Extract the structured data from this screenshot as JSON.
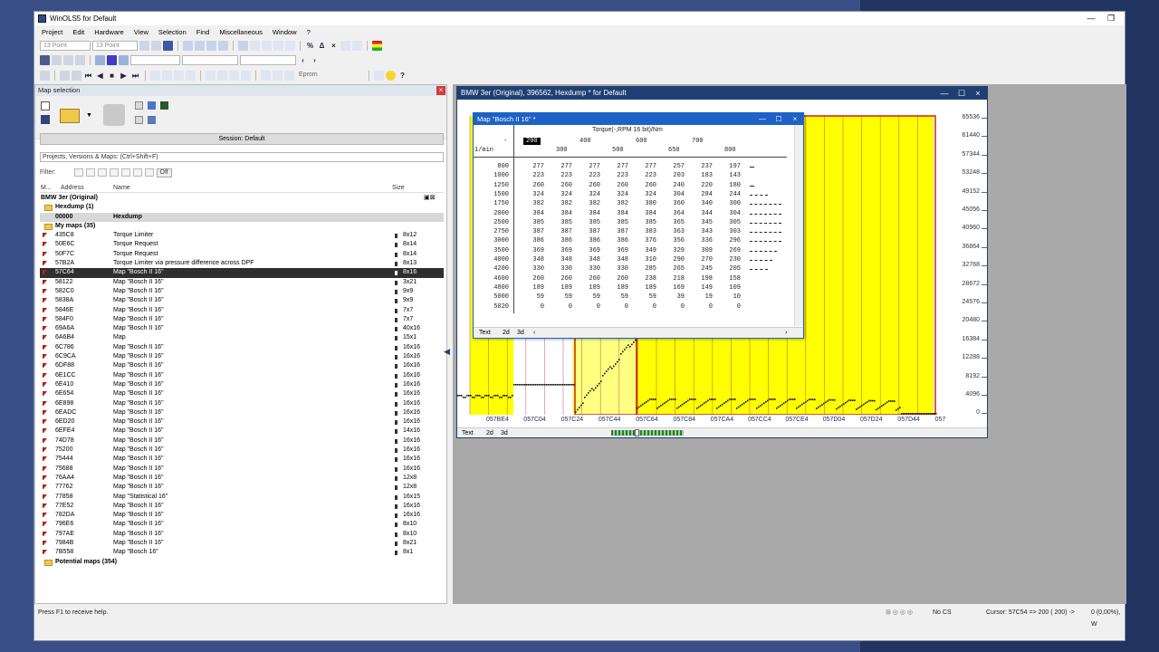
{
  "app": {
    "title": "WinOLS5 for Default"
  },
  "menu": [
    "Project",
    "Edit",
    "Hardware",
    "View",
    "Selection",
    "Find",
    "Miscellaneous",
    "Window",
    "?"
  ],
  "toolbar": {
    "font_size_1": "13 Point",
    "font_size_2": "13 Point",
    "eprom_label": "Eprom"
  },
  "left_panel": {
    "title": "Map selection",
    "session": "Session: Default",
    "projects_placeholder": "Projects, Versions & Maps:  (Ctrl+Shift+F)",
    "filter_label": "Filter:",
    "filter_off": "Off",
    "columns": {
      "m": "M...",
      "address": "Address",
      "name": "Name",
      "size": "Size"
    },
    "project": "BMW 3er (Original)",
    "hexdump_folder": "Hexdump (1)",
    "hexdump_row": {
      "address": "00000",
      "name": "Hexdump"
    },
    "mymaps_folder": "My maps (35)",
    "maps": [
      {
        "address": "435C8",
        "name": "Torque Limiter",
        "size": "8x12"
      },
      {
        "address": "50E6C",
        "name": "Torque Request",
        "size": "8x14"
      },
      {
        "address": "50F7C",
        "name": "Torque Request",
        "size": "8x14"
      },
      {
        "address": "57B2A",
        "name": "Torque Limiter via pressure difference across DPF",
        "size": "8x13"
      },
      {
        "address": "57C64",
        "name": "Map \"Bosch II 16\"",
        "size": "8x16",
        "selected": true
      },
      {
        "address": "58122",
        "name": "Map \"Bosch II 16\"",
        "size": "3x21"
      },
      {
        "address": "582C0",
        "name": "Map \"Bosch II 16\"",
        "size": "9x9"
      },
      {
        "address": "5838A",
        "name": "Map \"Bosch II 16\"",
        "size": "9x9"
      },
      {
        "address": "5846E",
        "name": "Map \"Bosch II 16\"",
        "size": "7x7"
      },
      {
        "address": "584F0",
        "name": "Map \"Bosch II 16\"",
        "size": "7x7"
      },
      {
        "address": "69A6A",
        "name": "Map \"Bosch II 16\"",
        "size": "40x16"
      },
      {
        "address": "6A6B4",
        "name": "Map",
        "size": "15x1"
      },
      {
        "address": "6C786",
        "name": "Map \"Bosch II 16\"",
        "size": "16x16"
      },
      {
        "address": "6C9CA",
        "name": "Map \"Bosch II 16\"",
        "size": "16x16"
      },
      {
        "address": "6DF88",
        "name": "Map \"Bosch II 16\"",
        "size": "16x16"
      },
      {
        "address": "6E1CC",
        "name": "Map \"Bosch II 16\"",
        "size": "16x16"
      },
      {
        "address": "6E410",
        "name": "Map \"Bosch II 16\"",
        "size": "16x16"
      },
      {
        "address": "6E654",
        "name": "Map \"Bosch II 16\"",
        "size": "16x16"
      },
      {
        "address": "6E898",
        "name": "Map \"Bosch II 16\"",
        "size": "16x16"
      },
      {
        "address": "6EADC",
        "name": "Map \"Bosch II 16\"",
        "size": "16x16"
      },
      {
        "address": "6ED20",
        "name": "Map \"Bosch II 16\"",
        "size": "16x16"
      },
      {
        "address": "6EFE4",
        "name": "Map \"Bosch II 16\"",
        "size": "14x16"
      },
      {
        "address": "74D78",
        "name": "Map \"Bosch II 16\"",
        "size": "16x16"
      },
      {
        "address": "75200",
        "name": "Map \"Bosch II 16\"",
        "size": "16x16"
      },
      {
        "address": "75444",
        "name": "Map \"Bosch II 16\"",
        "size": "16x16"
      },
      {
        "address": "75688",
        "name": "Map \"Bosch II 16\"",
        "size": "16x16"
      },
      {
        "address": "76AA4",
        "name": "Map \"Bosch II 16\"",
        "size": "12x8"
      },
      {
        "address": "77762",
        "name": "Map \"Bosch II 16\"",
        "size": "12x8"
      },
      {
        "address": "77858",
        "name": "Map \"Statistical 16\"",
        "size": "16x15"
      },
      {
        "address": "77E52",
        "name": "Map \"Bosch II 16\"",
        "size": "16x16"
      },
      {
        "address": "782DA",
        "name": "Map \"Bosch II 16\"",
        "size": "16x16"
      },
      {
        "address": "796E6",
        "name": "Map \"Bosch II 16\"",
        "size": "8x10"
      },
      {
        "address": "797AE",
        "name": "Map \"Bosch II 16\"",
        "size": "8x10"
      },
      {
        "address": "7984B",
        "name": "Map \"Bosch II 16\"",
        "size": "8x21"
      },
      {
        "address": "7B558",
        "name": "Map \"Bosch 16\"",
        "size": "8x1"
      }
    ],
    "potential_folder": "Potential maps (354)"
  },
  "status": {
    "help": "Press F1 to receive help.",
    "cs": "No CS",
    "cursor": "Cursor: 57C54 =>  200 ( 200) ->",
    "pct": "0 (0,00%), W"
  },
  "hex_window": {
    "title": "BMW 3er (Original), 396562, Hexdump * for Default",
    "ruler": [
      "65536",
      "61440",
      "57344",
      "53248",
      "49152",
      "45056",
      "40960",
      "36864",
      "32768",
      "28672",
      "24576",
      "20480",
      "16384",
      "12288",
      "8192",
      "4096",
      "0"
    ],
    "addresses": [
      "057BE4",
      "057C04",
      "057C24",
      "057C44",
      "057C64",
      "057C84",
      "057CA4",
      "057CC4",
      "057CE4",
      "057D04",
      "057D24",
      "057D44",
      "057"
    ],
    "tabs": [
      "Text",
      "2d",
      "3d"
    ]
  },
  "map_window": {
    "title": "Map \"Bosch II 16\" *",
    "header": "Torque(-,RPM 16 bit)/Nm",
    "row_axis_label": "1/min",
    "dash": "-",
    "cols_top": [
      "200",
      "400",
      "600",
      "700"
    ],
    "cols_bottom": [
      "300",
      "500",
      "650",
      "800"
    ],
    "rows": [
      {
        "rpm": "800",
        "v": [
          "277",
          "277",
          "277",
          "277",
          "277",
          "257",
          "237",
          "197"
        ]
      },
      {
        "rpm": "1000",
        "v": [
          "223",
          "223",
          "223",
          "223",
          "223",
          "203",
          "183",
          "143"
        ]
      },
      {
        "rpm": "1250",
        "v": [
          "260",
          "260",
          "260",
          "260",
          "260",
          "240",
          "220",
          "180"
        ]
      },
      {
        "rpm": "1500",
        "v": [
          "324",
          "324",
          "324",
          "324",
          "324",
          "304",
          "284",
          "244"
        ]
      },
      {
        "rpm": "1750",
        "v": [
          "382",
          "382",
          "382",
          "382",
          "380",
          "360",
          "340",
          "300"
        ]
      },
      {
        "rpm": "2000",
        "v": [
          "384",
          "384",
          "384",
          "384",
          "384",
          "364",
          "344",
          "304"
        ]
      },
      {
        "rpm": "2500",
        "v": [
          "385",
          "385",
          "385",
          "385",
          "385",
          "365",
          "345",
          "305"
        ]
      },
      {
        "rpm": "2750",
        "v": [
          "387",
          "387",
          "387",
          "387",
          "383",
          "363",
          "343",
          "303"
        ]
      },
      {
        "rpm": "3000",
        "v": [
          "386",
          "386",
          "386",
          "386",
          "376",
          "356",
          "336",
          "296"
        ]
      },
      {
        "rpm": "3500",
        "v": [
          "369",
          "369",
          "369",
          "369",
          "349",
          "329",
          "309",
          "269"
        ]
      },
      {
        "rpm": "4000",
        "v": [
          "348",
          "348",
          "348",
          "348",
          "310",
          "290",
          "270",
          "230"
        ]
      },
      {
        "rpm": "4200",
        "v": [
          "330",
          "330",
          "330",
          "330",
          "285",
          "265",
          "245",
          "205"
        ]
      },
      {
        "rpm": "4600",
        "v": [
          "260",
          "260",
          "260",
          "260",
          "238",
          "218",
          "198",
          "158"
        ]
      },
      {
        "rpm": "4800",
        "v": [
          "189",
          "189",
          "189",
          "189",
          "189",
          "169",
          "149",
          "109"
        ]
      },
      {
        "rpm": "5000",
        "v": [
          "59",
          "59",
          "59",
          "59",
          "59",
          "39",
          "19",
          "10"
        ]
      },
      {
        "rpm": "5020",
        "v": [
          "0",
          "0",
          "0",
          "0",
          "0",
          "0",
          "0",
          "0"
        ]
      }
    ],
    "tabs": [
      "Text",
      "2d",
      "3d"
    ]
  },
  "colors": {
    "accent": "#1f3f73",
    "selection": "#2f2f2f",
    "hex_yellow": "#ffff00",
    "map_red": "#cc2222"
  }
}
